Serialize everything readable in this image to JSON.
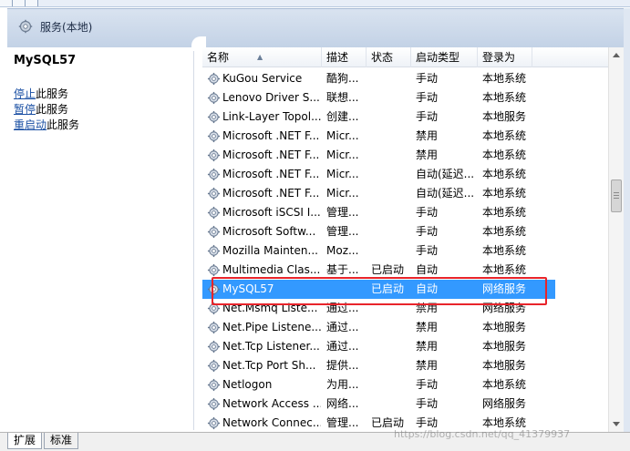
{
  "header": {
    "title": "服务(本地)",
    "icon": "gear-icon"
  },
  "left_pane": {
    "service_name": "MySQL57",
    "actions": [
      {
        "link": "停止",
        "rest": "此服务"
      },
      {
        "link": "暂停",
        "rest": "此服务"
      },
      {
        "link": "重启动",
        "rest": "此服务"
      }
    ]
  },
  "table": {
    "columns": [
      "名称",
      "描述",
      "状态",
      "启动类型",
      "登录为"
    ],
    "rows": [
      {
        "name": "KuGou Service",
        "desc": "酷狗...",
        "status": "",
        "startup": "手动",
        "logon": "本地系统"
      },
      {
        "name": "Lenovo Driver S...",
        "desc": "联想...",
        "status": "",
        "startup": "手动",
        "logon": "本地系统"
      },
      {
        "name": "Link-Layer Topol...",
        "desc": "创建...",
        "status": "",
        "startup": "手动",
        "logon": "本地服务"
      },
      {
        "name": "Microsoft .NET F...",
        "desc": "Micr...",
        "status": "",
        "startup": "禁用",
        "logon": "本地系统"
      },
      {
        "name": "Microsoft .NET F...",
        "desc": "Micr...",
        "status": "",
        "startup": "禁用",
        "logon": "本地系统"
      },
      {
        "name": "Microsoft .NET F...",
        "desc": "Micr...",
        "status": "",
        "startup": "自动(延迟...",
        "logon": "本地系统"
      },
      {
        "name": "Microsoft .NET F...",
        "desc": "Micr...",
        "status": "",
        "startup": "自动(延迟...",
        "logon": "本地系统"
      },
      {
        "name": "Microsoft iSCSI I...",
        "desc": "管理...",
        "status": "",
        "startup": "手动",
        "logon": "本地系统"
      },
      {
        "name": "Microsoft Softw...",
        "desc": "管理...",
        "status": "",
        "startup": "手动",
        "logon": "本地系统"
      },
      {
        "name": "Mozilla Mainten...",
        "desc": "Moz...",
        "status": "",
        "startup": "手动",
        "logon": "本地系统"
      },
      {
        "name": "Multimedia Clas...",
        "desc": "基于...",
        "status": "已启动",
        "startup": "自动",
        "logon": "本地系统"
      },
      {
        "name": "MySQL57",
        "desc": "",
        "status": "已启动",
        "startup": "自动",
        "logon": "网络服务",
        "selected": true
      },
      {
        "name": "Net.Msmq Liste...",
        "desc": "通过...",
        "status": "",
        "startup": "禁用",
        "logon": "网络服务"
      },
      {
        "name": "Net.Pipe Listene...",
        "desc": "通过...",
        "status": "",
        "startup": "禁用",
        "logon": "本地服务"
      },
      {
        "name": "Net.Tcp Listener...",
        "desc": "通过...",
        "status": "",
        "startup": "禁用",
        "logon": "本地服务"
      },
      {
        "name": "Net.Tcp Port Sh...",
        "desc": "提供...",
        "status": "",
        "startup": "禁用",
        "logon": "本地服务"
      },
      {
        "name": "Netlogon",
        "desc": "为用...",
        "status": "",
        "startup": "手动",
        "logon": "本地系统"
      },
      {
        "name": "Network Access ...",
        "desc": "网络...",
        "status": "",
        "startup": "手动",
        "logon": "网络服务"
      },
      {
        "name": "Network Connec...",
        "desc": "管理...",
        "status": "已启动",
        "startup": "手动",
        "logon": "本地系统"
      }
    ]
  },
  "tabs": [
    "扩展",
    "标准"
  ],
  "watermark": "https://blog.csdn.net/qq_41379937",
  "colors": {
    "selection": "#3399ff",
    "highlight_border": "#e8242b",
    "link": "#1a4fa3"
  }
}
